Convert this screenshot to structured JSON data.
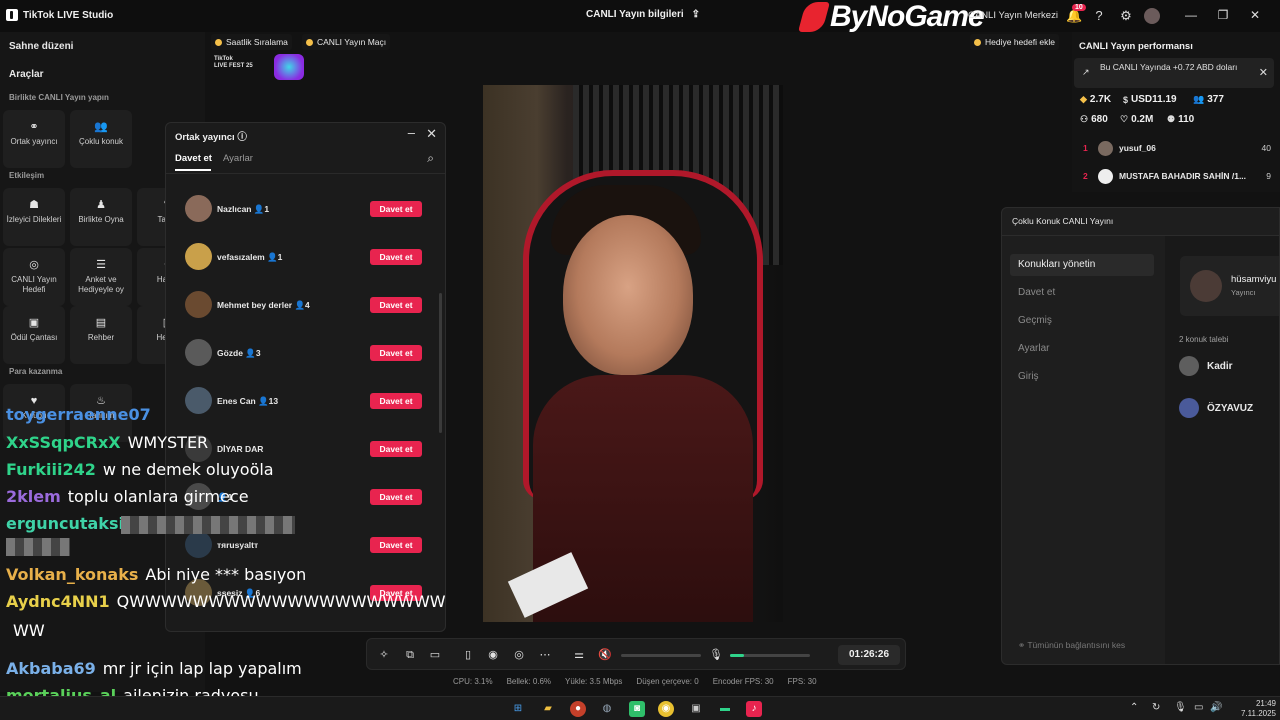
{
  "titlebar": {
    "app_title": "TikTok LIVE Studio",
    "center_title": "CANLI Yayın bilgileri",
    "watermark": "ByNoGame",
    "live_center": "CANLI Yayın Merkezi",
    "notif_count": "10"
  },
  "sidebar": {
    "scene_heading": "Sahne düzeni",
    "tools_heading": "Araçlar",
    "together_sub": "Birlikte CANLI Yayın yapın",
    "tools_row1": [
      {
        "label": "Ortak yayıncı",
        "icon": "link-icon"
      },
      {
        "label": "Çoklu konuk",
        "icon": "users-icon"
      }
    ],
    "interaction_sub": "Etkileşim",
    "tools_row2": [
      {
        "label": "İzleyici Dilekleri",
        "icon": "wishes-icon"
      },
      {
        "label": "Birlikte Oyna",
        "icon": "play-together-icon"
      },
      {
        "label": "Tal oy",
        "icon": "vote-icon"
      }
    ],
    "tools_row3": [
      {
        "label": "CANLI Yayın Hedefi",
        "icon": "goal-icon"
      },
      {
        "label": "Anket ve Hediyeyle oy",
        "icon": "poll-icon"
      },
      {
        "label": "Ha Ku",
        "icon": "gift-icon"
      }
    ],
    "tools_row4": [
      {
        "label": "Ödül Çantası",
        "icon": "bag-icon"
      },
      {
        "label": "Rehber",
        "icon": "guide-icon"
      },
      {
        "label": "He Ga",
        "icon": "gallery-icon"
      }
    ],
    "earn_sub": "Para kazanma",
    "tools_row5": [
      {
        "label": "Kulübü",
        "icon": "heart-icon"
      },
      {
        "label": "Tanıtım",
        "icon": "fire-icon"
      }
    ]
  },
  "top_strip": {
    "hourly_rank": "Saatlik Sıralama",
    "live_match": "CANLI Yayın Maçı",
    "fest_label_1": "TikTok",
    "fest_label_2": "LIVE FEST 25",
    "gift_goal": "Hediye hedefi ekle"
  },
  "cohost_modal": {
    "title": "Ortak yayıncı",
    "tab_invite": "Davet et",
    "tab_settings": "Ayarlar",
    "invite_label": "Davet et",
    "rows": [
      {
        "name": "Nazlıcan",
        "count": "1",
        "color": "#8a6a5a"
      },
      {
        "name": "vefasızalem",
        "count": "1",
        "color": "#c9a04a"
      },
      {
        "name": "Mehmet bey derler",
        "count": "4",
        "color": "#6a4a30"
      },
      {
        "name": "Gözde",
        "count": "3",
        "color": "#5a5a5a"
      },
      {
        "name": "Enes Can",
        "count": "13",
        "color": "#4a5a6a"
      },
      {
        "name": "DİYAR DAR",
        "count": "",
        "color": "#3a3a3a"
      },
      {
        "name": "",
        "count": "1",
        "color": "#4a4a4a"
      },
      {
        "name": "тяrusyaltт",
        "count": "",
        "color": "#2a3a4a"
      },
      {
        "name": "ssesiz",
        "count": "6",
        "color": "#6a5a3a"
      }
    ]
  },
  "control_bar": {
    "timer": "01:26:26",
    "mic_level": 0.18
  },
  "stats_bar": {
    "cpu": "CPU: 3.1%",
    "memory": "Bellek: 0.6%",
    "upload": "Yükle: 3.5 Mbps",
    "dropped": "Düşen çerçeve: 0",
    "encoder_fps": "Encoder FPS: 30",
    "fps": "FPS: 30"
  },
  "performance": {
    "title": "CANLI Yayın performansı",
    "note": "Bu CANLI Yayında +0.72 ABD doları",
    "diamonds": "2.7K",
    "usd": "USD11.19",
    "viewers": "377",
    "new_followers": "680",
    "likes": "0.2M",
    "gifters": "110",
    "ranking": [
      {
        "rank": "1",
        "user": "yusuf_06",
        "value": "40"
      },
      {
        "rank": "2",
        "user": "MUSTAFA BAHADIR SAHİN /1...",
        "value": "9"
      }
    ]
  },
  "multi_guest": {
    "title": "Çoklu Konuk CANLI Yayını",
    "nav": [
      "Konukları yönetin",
      "Davet et",
      "Geçmiş",
      "Ayarlar",
      "Giriş"
    ],
    "host_name": "hüsamviyu",
    "host_role": "Yayıncı",
    "requests_heading": "2 konuk talebi",
    "guests": [
      "Kadir",
      "ÖZYAVUZ"
    ],
    "footer": "Tümünün bağlantısını kes"
  },
  "chat": [
    {
      "user": "toygerraenne07",
      "msg": "",
      "color": "#4a90e2"
    },
    {
      "user": "XxSSqpCRxX",
      "msg": "WMYSTER",
      "color": "#2fd38a"
    },
    {
      "user": "Furkiii242",
      "msg": "w ne demek oluyoöla",
      "color": "#2fd38a"
    },
    {
      "user": "2klem",
      "msg": "toplu olanlara girmece",
      "color": "#9b6bdc"
    },
    {
      "user": "erguncutaksi",
      "msg": "",
      "color": "#3fd3a8"
    },
    {
      "user": "Volkan_konaks",
      "msg": "Abi niye *** basıyon",
      "color": "#e8b04a"
    },
    {
      "user": "Aydnc4NN1",
      "msg": "QWWWWWWWWWWWWWWWWWWWW",
      "color": "#e8d04a"
    },
    {
      "user": "",
      "msg": "WW",
      "color": "#ffffff"
    },
    {
      "user": "Akbaba69",
      "msg": "mr jr için lap lap yapalım",
      "color": "#7ab0e8"
    },
    {
      "user": "mortalius_al",
      "msg": "ailenizin radyosu",
      "color": "#5ad05a"
    }
  ],
  "taskbar": {
    "time": "21:49",
    "date": "7.11.2025"
  }
}
